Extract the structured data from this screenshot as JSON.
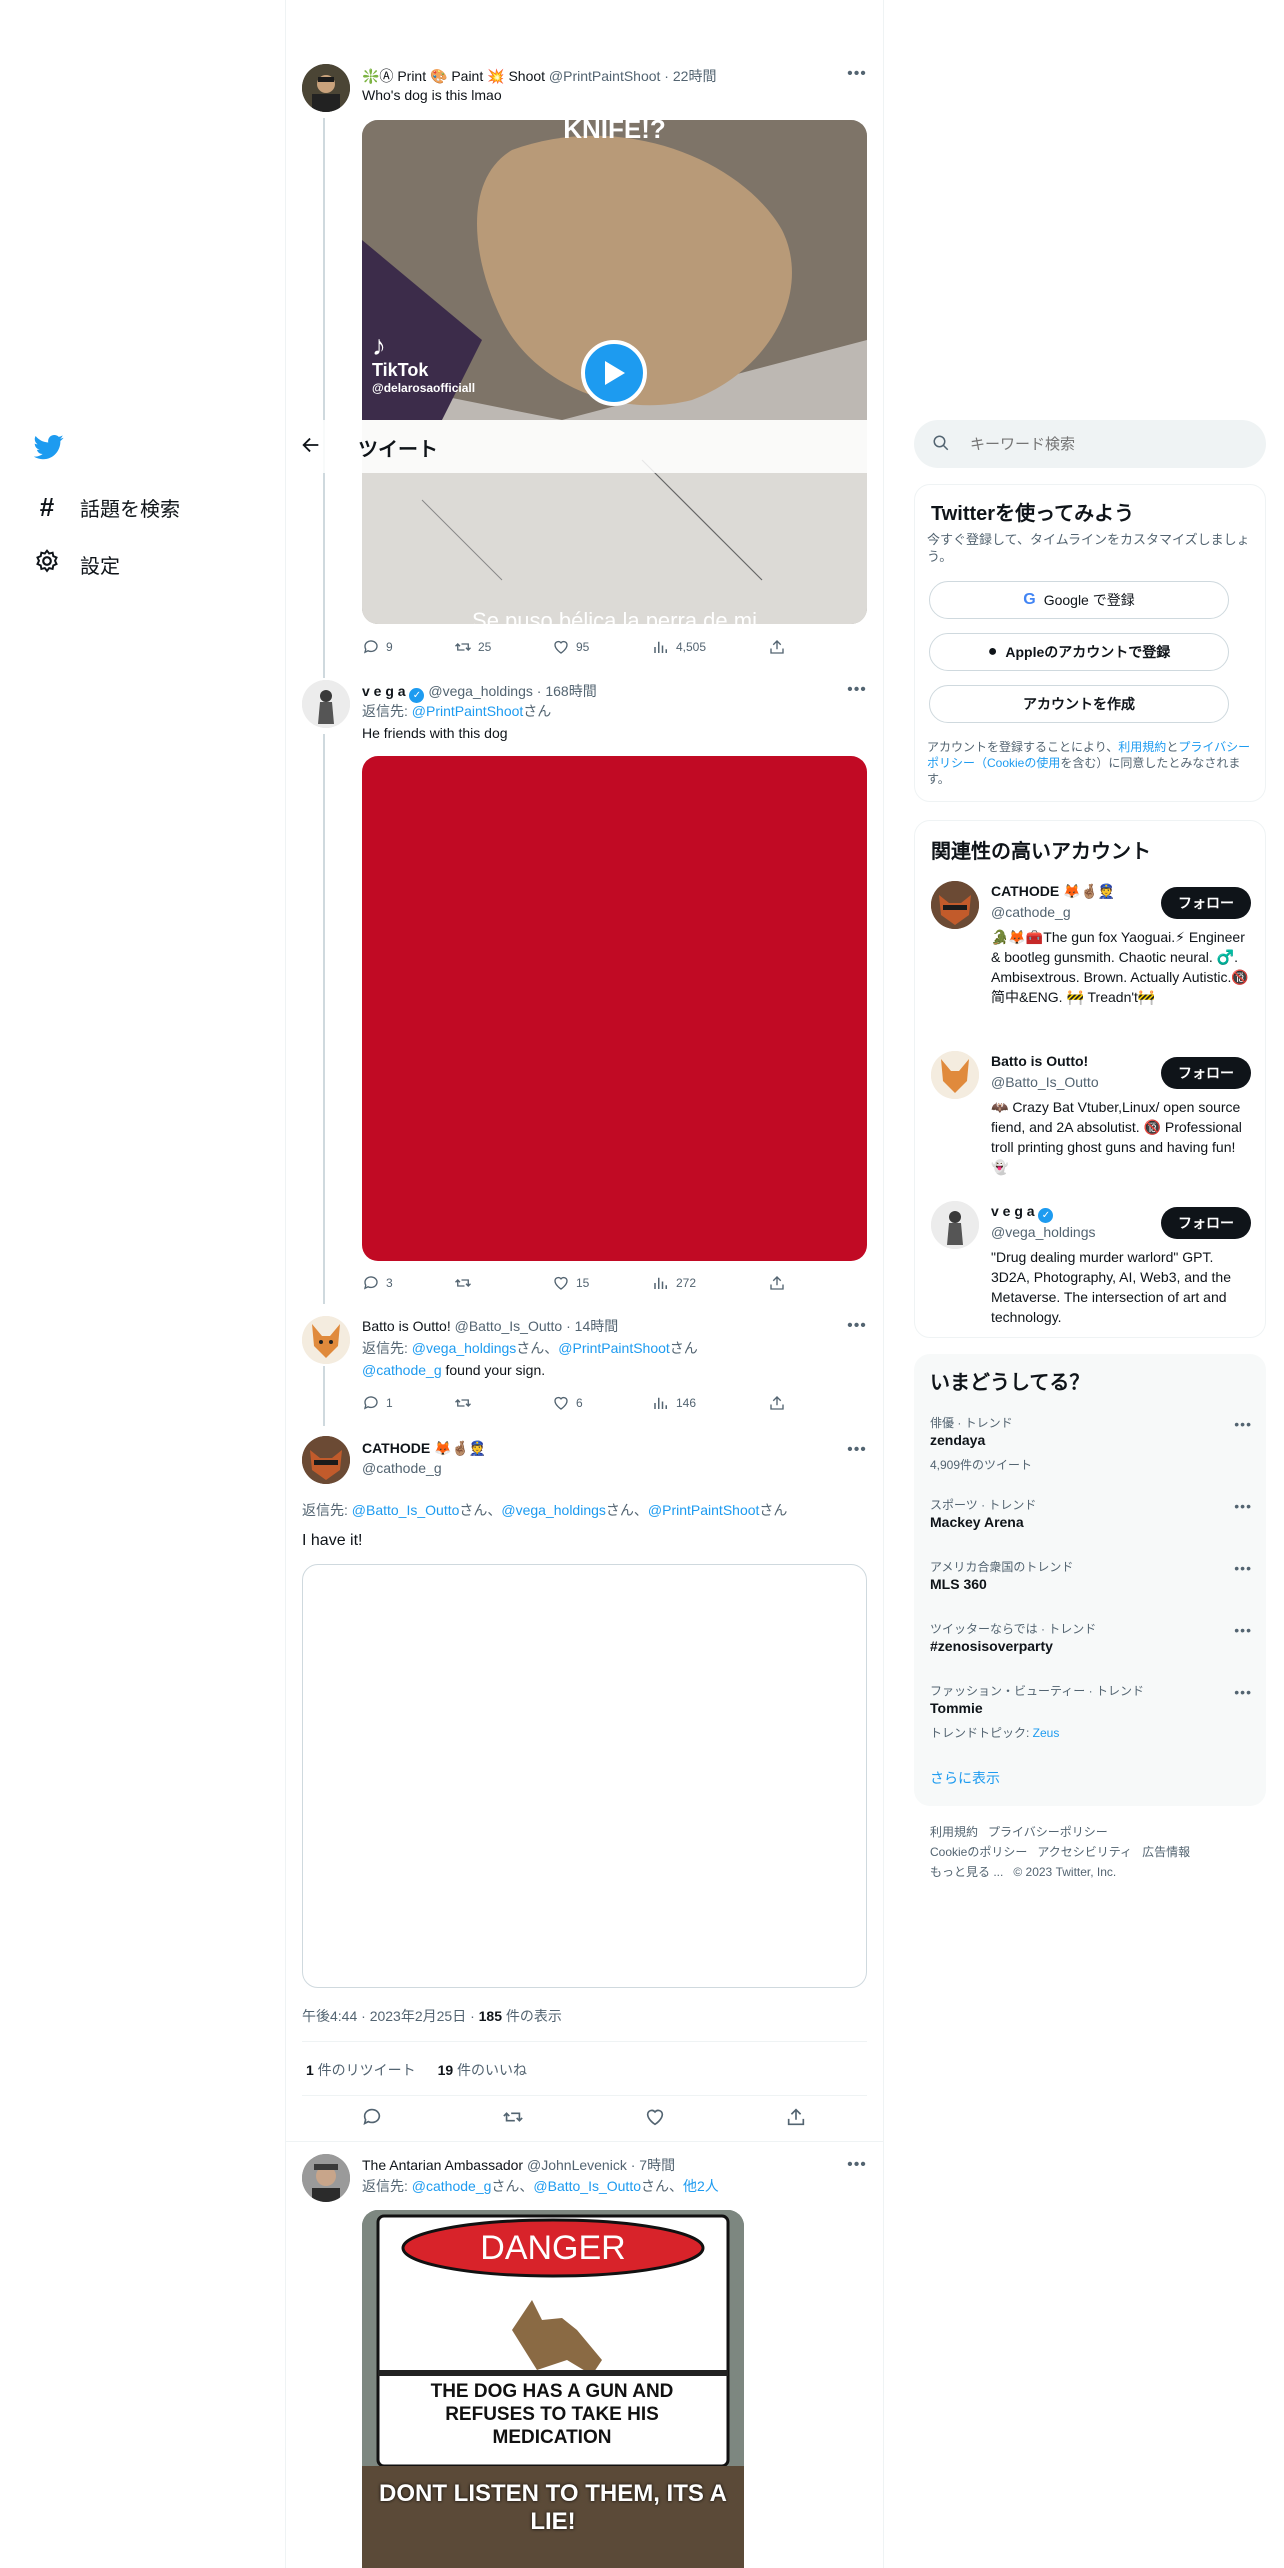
{
  "nav": {
    "items": [
      {
        "label": "話題を検索",
        "icon": "hashtag-icon"
      },
      {
        "label": "設定",
        "icon": "gear-icon"
      }
    ]
  },
  "header": {
    "title": "ツイート"
  },
  "tweets": {
    "t1": {
      "name": "❇️Ⓐ Print 🎨 Paint 💥 Shoot",
      "handle": "@PrintPaintShoot",
      "time": "22時間",
      "text": "Who's dog is this lmao",
      "video_top_text": "KNIFE!?",
      "video_bottom_text": "Se puso bélica la perra de mi",
      "tiktok_label": "TikTok",
      "tiktok_user": "@delarosaofficiall",
      "replies": "9",
      "retweets": "25",
      "likes": "95",
      "views": "4,505"
    },
    "t2": {
      "name": "v e g a",
      "handle": "@vega_holdings",
      "time": "168時間",
      "reply_prefix": "返信先: ",
      "reply_to": "@PrintPaintShoot",
      "reply_suffix": "さん",
      "text": "He friends with this dog",
      "replies": "3",
      "likes": "15",
      "views": "272"
    },
    "t3": {
      "name": "Batto is Outto!",
      "handle": "@Batto_Is_Outto",
      "time": "14時間",
      "reply_prefix": "返信先: ",
      "reply_to_1": "@vega_holdings",
      "reply_mid": "さん、",
      "reply_to_2": "@PrintPaintShoot",
      "reply_suffix": "さん",
      "mention": "@cathode_g",
      "text": " found your sign.",
      "replies": "1",
      "likes": "6",
      "views": "146"
    },
    "main": {
      "name": "CATHODE 🦊🤞🏽👮",
      "handle": "@cathode_g",
      "reply_prefix": "返信先: ",
      "reply_to_1": "@Batto_Is_Outto",
      "s1": "さん、",
      "reply_to_2": "@vega_holdings",
      "s2": "さん、",
      "reply_to_3": "@PrintPaintShoot",
      "s3": "さん",
      "text": "I have it!",
      "timestamp": "午後4:44 · 2023年2月25日 · ",
      "views_num": "185",
      "views_label": " 件の表示",
      "rt_num": "1",
      "rt_label": " 件のリツイート",
      "like_num": "19",
      "like_label": " 件のいいね"
    },
    "t5": {
      "name": "The Antarian Ambassador",
      "handle": "@JohnLevenick",
      "time": "7時間",
      "reply_prefix": "返信先: ",
      "reply_to_1": "@cathode_g",
      "s1": "さん、",
      "reply_to_2": "@Batto_Is_Outto",
      "s2": "さん、",
      "others": "他2人",
      "sign_top": "DANGER",
      "sign_text": "THE DOG HAS A GUN AND REFUSES TO TAKE HIS MEDICATION",
      "meme_bottom": "DONT LISTEN TO THEM, ITS A LIE!"
    }
  },
  "search": {
    "placeholder": "キーワード検索"
  },
  "signup": {
    "title": "Twitterを使ってみよう",
    "subtitle": "今すぐ登録して、タイムラインをカスタマイズしましょう。",
    "google": "Google で登録",
    "apple": "Appleのアカウントで登録",
    "create": "アカウントを作成",
    "legal_1": "アカウントを登録することにより、",
    "terms": "利用規約",
    "legal_2": "と",
    "privacy": "プライバシーポリシー（Cookieの使用",
    "legal_3": "を含む）に同意したとみなされます。"
  },
  "relevant": {
    "title": "関連性の高いアカウント",
    "follow": "フォロー",
    "accounts": [
      {
        "name": "CATHODE 🦊🤞🏽👮",
        "handle": "@cathode_g",
        "bio": "🐊🦊🧰The gun fox Yaoguai.⚡ Engineer & bootleg gunsmith. Chaotic neural. ♂️. Ambisextrous. Brown. Actually Autistic.🔞 简中&ENG. 🚧 Treadn't🚧"
      },
      {
        "name": "Batto is Outto!",
        "handle": "@Batto_Is_Outto",
        "bio": "🦇 Crazy Bat Vtuber,Linux/ open source fiend, and 2A absolutist. 🔞 Professional troll printing ghost guns and having fun! 👻"
      },
      {
        "name": "v e g a",
        "handle": "@vega_holdings",
        "bio": "\"Drug dealing murder warlord\" GPT. 3D2A, Photography, AI, Web3, and the Metaverse. The intersection of art and technology."
      }
    ]
  },
  "trends": {
    "title": "いまどうしてる？",
    "items": [
      {
        "category": "俳優 · トレンド",
        "name": "zendaya",
        "sub": "4,909件のツイート"
      },
      {
        "category": "スポーツ · トレンド",
        "name": "Mackey Arena",
        "sub": ""
      },
      {
        "category": "アメリカ合衆国のトレンド",
        "name": "MLS 360",
        "sub": ""
      },
      {
        "category": "ツイッターならでは · トレンド",
        "name": "#zenosisoverparty",
        "sub": ""
      },
      {
        "category": "ファッション・ビューティー · トレンド",
        "name": "Tommie",
        "sub_prefix": "トレンドトピック: ",
        "sub_link": "Zeus"
      }
    ],
    "show_more": "さらに表示"
  },
  "footer": {
    "links": [
      "利用規約",
      "プライバシーポリシー",
      "Cookieのポリシー",
      "アクセシビリティ",
      "広告情報",
      "もっと見る ..."
    ],
    "copyright": "© 2023 Twitter, Inc."
  },
  "colors": {
    "accent": "#1d9bf0",
    "red_image": "#c10a24",
    "follow_btn": "#0f1419"
  }
}
